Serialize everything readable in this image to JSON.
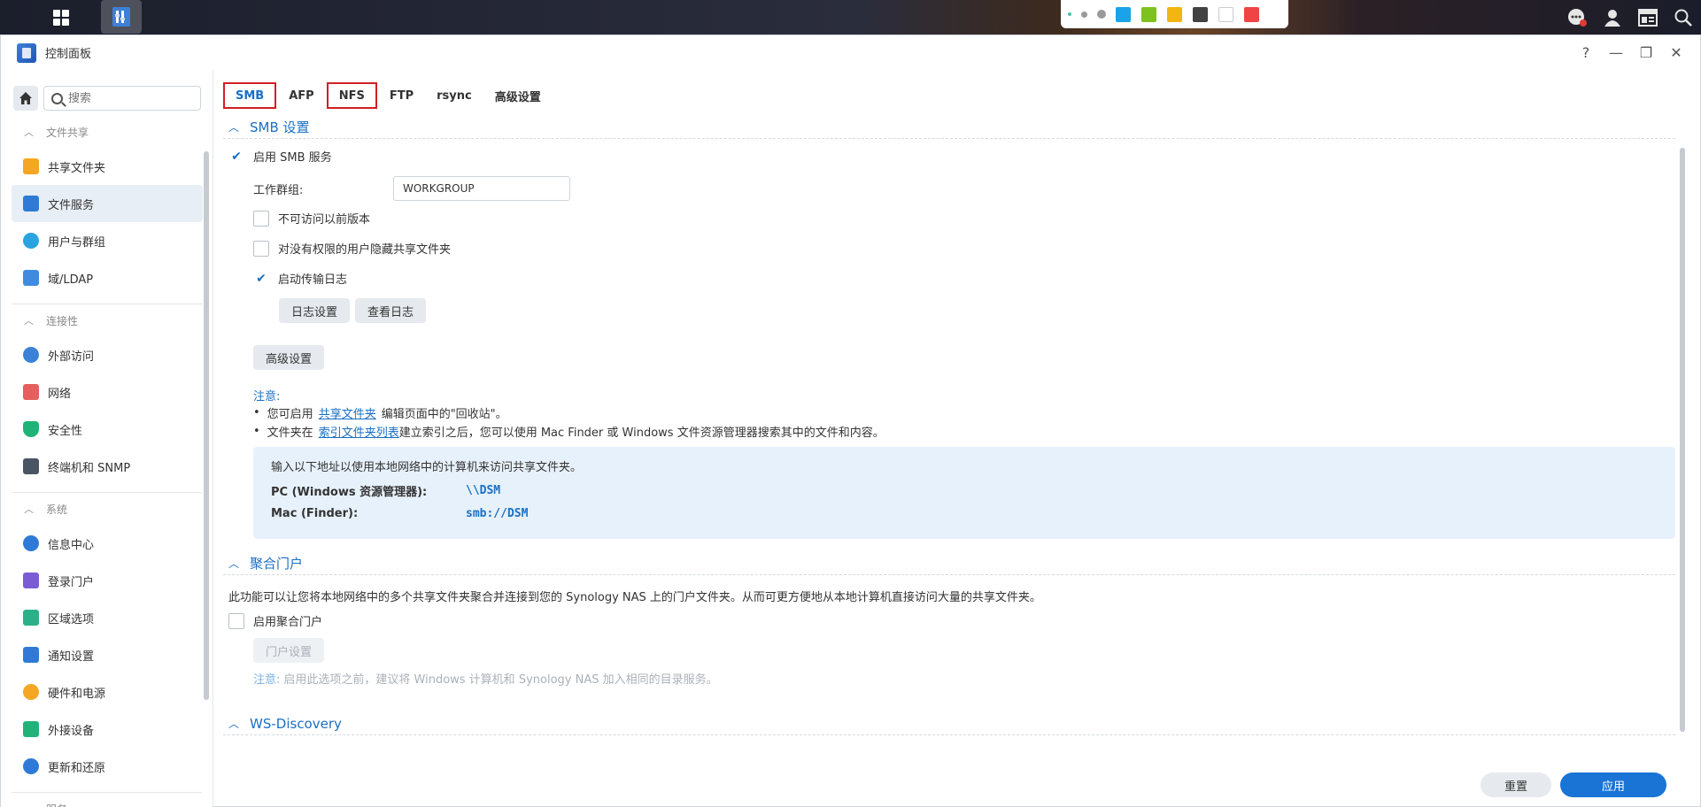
{
  "taskbar": {
    "color_swatches": [
      "#1aa3e8",
      "#7dc21e",
      "#f3b512",
      "#424242",
      "#ffffff",
      "#ef4444"
    ]
  },
  "window": {
    "title": "控制面板",
    "controls": [
      "?",
      "—",
      "❐",
      "✕"
    ]
  },
  "sidebar": {
    "search_placeholder": "搜索",
    "sections": [
      {
        "label": "文件共享",
        "items": [
          "共享文件夹",
          "文件服务",
          "用户与群组",
          "域/LDAP"
        ]
      },
      {
        "label": "连接性",
        "items": [
          "外部访问",
          "网络",
          "安全性",
          "终端机和 SNMP"
        ]
      },
      {
        "label": "系统",
        "items": [
          "信息中心",
          "登录门户",
          "区域选项",
          "通知设置",
          "硬件和电源",
          "外接设备",
          "更新和还原"
        ]
      },
      {
        "label": "服务"
      }
    ],
    "active_item": "文件服务"
  },
  "tabs": [
    "SMB",
    "AFP",
    "NFS",
    "FTP",
    "rsync",
    "高级设置"
  ],
  "smb": {
    "section_title": "SMB 设置",
    "enable_label": "启用 SMB 服务",
    "enable_checked": true,
    "workgroup_label": "工作群组:",
    "workgroup_value": "WORKGROUP",
    "no_prev_versions_label": "不可访问以前版本",
    "hide_shares_label": "对没有权限的用户隐藏共享文件夹",
    "transfer_log_label": "启动传输日志",
    "transfer_log_checked": true,
    "log_settings_button": "日志设置",
    "view_log_button": "查看日志",
    "advanced_button": "高级设置",
    "note_title": "注意:",
    "note1_prefix": "您可启用",
    "note1_link": "共享文件夹",
    "note1_suffix": "编辑页面中的\"回收站\"。",
    "note2_prefix": "文件夹在",
    "note2_link": "索引文件夹列表",
    "note2_suffix": "建立索引之后，您可以使用 Mac Finder 或 Windows 文件资源管理器搜索其中的文件和内容。",
    "info_intro": "输入以下地址以使用本地网络中的计算机来访问共享文件夹。",
    "pc_label": "PC (Windows 资源管理器):",
    "pc_value": "\\\\DSM",
    "mac_label": "Mac (Finder):",
    "mac_value": "smb://DSM"
  },
  "aggregation": {
    "section_title": "聚合门户",
    "description": "此功能可以让您将本地网络中的多个共享文件夹聚合并连接到您的 Synology NAS 上的门户文件夹。从而可更方便地从本地计算机直接访问大量的共享文件夹。",
    "enable_label": "启用聚合门户",
    "portal_settings_button": "门户设置",
    "note_title": "注意:",
    "note_text": "启用此选项之前，建议将 Windows 计算机和 Synology NAS 加入相同的目录服务。"
  },
  "wsd": {
    "section_title": "WS-Discovery"
  },
  "footer": {
    "reset_button": "重置",
    "apply_button": "应用"
  }
}
